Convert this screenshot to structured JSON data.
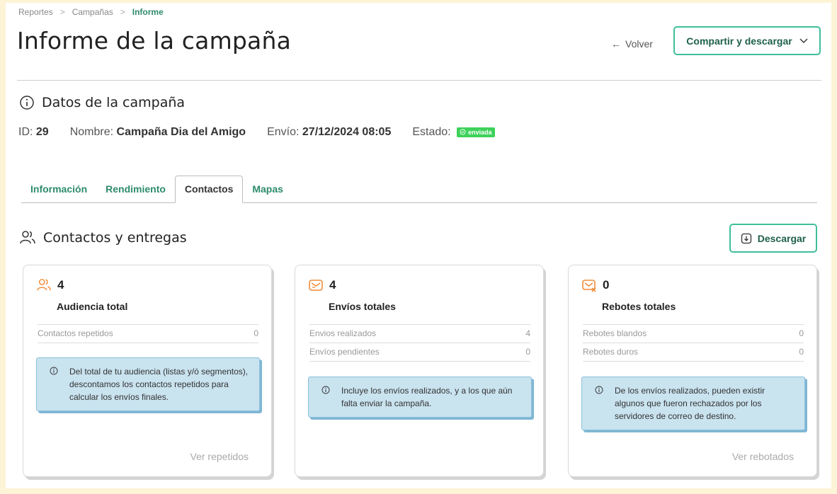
{
  "breadcrumb": [
    "Reportes",
    "Campañas",
    "Informe"
  ],
  "page_title": "Informe de la campaña",
  "back_label": "Volver",
  "share_label": "Compartir y descargar",
  "datos": {
    "title": "Datos de la campaña",
    "id_label": "ID:",
    "id_value": "29",
    "nombre_label": "Nombre:",
    "nombre_value": "Campaña Dia del Amigo",
    "envio_label": "Envío:",
    "envio_value": "27/12/2024 08:05",
    "estado_label": "Estado:",
    "estado_value": "enviada"
  },
  "tabs": [
    "Información",
    "Rendimiento",
    "Contactos",
    "Mapas"
  ],
  "active_tab": "Contactos",
  "contactos": {
    "title": "Contactos y entregas",
    "download_label": "Descargar"
  },
  "cards": [
    {
      "icon": "users-icon",
      "count": "4",
      "title": "Audiencia total",
      "rows": [
        {
          "label": "Contactos repetidos",
          "value": "0"
        }
      ],
      "info": "Del total de tu audiencia (listas y/ó segmentos), descontamos los contactos repetidos para calcular los envíos finales.",
      "link": "Ver repetidos"
    },
    {
      "icon": "mail-sent-icon",
      "count": "4",
      "title": "Envíos totales",
      "rows": [
        {
          "label": "Envios realizados",
          "value": "4"
        },
        {
          "label": "Envíos pendientes",
          "value": "0"
        }
      ],
      "info": "Incluye los envíos realizados, y a los que aún falta enviar la campaña.",
      "link": ""
    },
    {
      "icon": "mail-bounce-icon",
      "count": "0",
      "title": "Rebotes totales",
      "rows": [
        {
          "label": "Rebotes blandos",
          "value": "0"
        },
        {
          "label": "Rebotes duros",
          "value": "0"
        }
      ],
      "info": "De los envíos realizados, pueden existir algunos que fueron rechazados por los servidores de correo de destino.",
      "link": "Ver rebotados"
    }
  ],
  "colors": {
    "accent": "#3fbf9a",
    "accent_text": "#2e8b6b",
    "icon_orange": "#f28c3a",
    "badge_green": "#3ed15b",
    "info_bg": "#c9e3ef"
  }
}
